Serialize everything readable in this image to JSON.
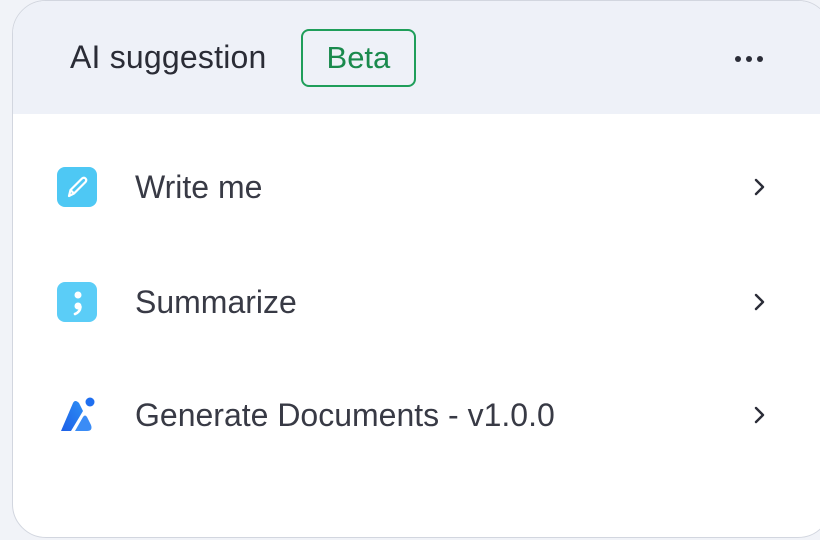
{
  "header": {
    "title": "AI suggestion",
    "badge": "Beta",
    "more_icon": "more-horizontal-icon"
  },
  "items": [
    {
      "label": "Write me",
      "icon": "pencil-icon",
      "icon_color": "#4ec8f4"
    },
    {
      "label": "Summarize",
      "icon": "summarize-icon",
      "icon_color": "#5bcdf7"
    },
    {
      "label": "Generate Documents - v1.0.0",
      "icon": "ai-logo-icon",
      "icon_color": "#1f6ff0"
    }
  ],
  "colors": {
    "header_bg": "#eef1f8",
    "badge_green": "#1f9e5a",
    "text": "#383a45"
  }
}
